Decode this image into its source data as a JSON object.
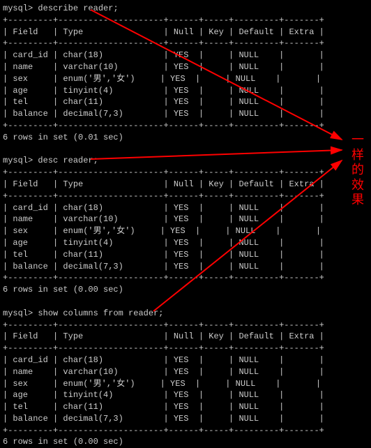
{
  "prompt": "mysql>",
  "commands": {
    "cmd1": "describe reader;",
    "cmd2": "desc reader;",
    "cmd3": "show columns from reader;"
  },
  "table": {
    "border_top": "+---------+---------------------+------+-----+---------+-------+",
    "header_row": "| Field   | Type                | Null | Key | Default | Extra |",
    "border_mid": "+---------+---------------------+------+-----+---------+-------+",
    "rows": [
      "| card_id | char(18)            | YES  |     | NULL    |       |",
      "| name    | varchar(10)         | YES  |     | NULL    |       |",
      "| sex     | enum('男','女')     | YES  |     | NULL    |       |",
      "| age     | tinyint(4)          | YES  |     | NULL    |       |",
      "| tel     | char(11)            | YES  |     | NULL    |       |",
      "| balance | decimal(7,3)        | YES  |     | NULL    |       |"
    ],
    "border_bot": "+---------+---------------------+------+-----+---------+-------+"
  },
  "footers": {
    "f1": "6 rows in set (0.01 sec)",
    "f2": "6 rows in set (0.00 sec)",
    "f3": "6 rows in set (0.00 sec)"
  },
  "annotation": "一样的效果",
  "chart_data": {
    "type": "table",
    "title": "reader table schema (MySQL describe output)",
    "columns": [
      "Field",
      "Type",
      "Null",
      "Key",
      "Default",
      "Extra"
    ],
    "rows": [
      {
        "Field": "card_id",
        "Type": "char(18)",
        "Null": "YES",
        "Key": "",
        "Default": "NULL",
        "Extra": ""
      },
      {
        "Field": "name",
        "Type": "varchar(10)",
        "Null": "YES",
        "Key": "",
        "Default": "NULL",
        "Extra": ""
      },
      {
        "Field": "sex",
        "Type": "enum('男','女')",
        "Null": "YES",
        "Key": "",
        "Default": "NULL",
        "Extra": ""
      },
      {
        "Field": "age",
        "Type": "tinyint(4)",
        "Null": "YES",
        "Key": "",
        "Default": "NULL",
        "Extra": ""
      },
      {
        "Field": "tel",
        "Type": "char(11)",
        "Null": "YES",
        "Key": "",
        "Default": "NULL",
        "Extra": ""
      },
      {
        "Field": "balance",
        "Type": "decimal(7,3)",
        "Null": "YES",
        "Key": "",
        "Default": "NULL",
        "Extra": ""
      }
    ]
  }
}
